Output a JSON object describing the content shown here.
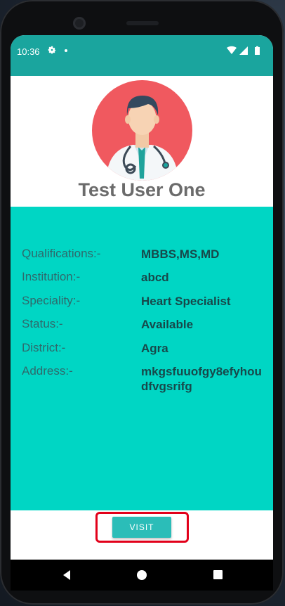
{
  "status_bar": {
    "time": "10:36",
    "icons": [
      "gear-icon",
      "dot-icon",
      "wifi-icon",
      "signal-icon",
      "battery-icon"
    ]
  },
  "profile": {
    "name": "Test User One",
    "avatar_icon": "doctor-avatar-icon"
  },
  "details": [
    {
      "label": "Qualifications:-",
      "value": "MBBS,MS,MD"
    },
    {
      "label": "Institution:-",
      "value": "abcd"
    },
    {
      "label": "Speciality:-",
      "value": "Heart Specialist"
    },
    {
      "label": "Status:-",
      "value": "Available"
    },
    {
      "label": "District:-",
      "value": "Agra"
    },
    {
      "label": "Address:-",
      "value": "mkgsfuuofgy8efyhoudfvgsrifg"
    }
  ],
  "actions": {
    "visit_label": "VISIT"
  },
  "colors": {
    "status_bar": "#1aa59e",
    "panel": "#00d6c4",
    "button": "#2bbdb8",
    "highlight": "#e2001a",
    "avatar_bg": "#f0595f"
  },
  "nav_bar": {
    "icons": [
      "back-icon",
      "home-icon",
      "recents-icon"
    ]
  }
}
